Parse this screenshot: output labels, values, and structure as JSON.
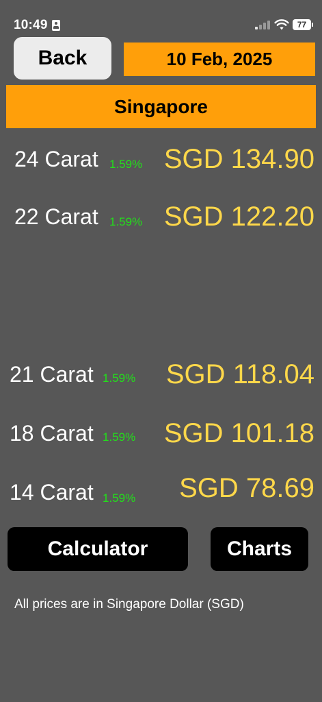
{
  "status_bar": {
    "time": "10:49",
    "battery": "77"
  },
  "header": {
    "back_label": "Back",
    "date": "10 Feb, 2025"
  },
  "location": "Singapore",
  "prices": [
    {
      "carat": "24 Carat",
      "change": "1.59%",
      "price": "SGD 134.90"
    },
    {
      "carat": "22 Carat",
      "change": "1.59%",
      "price": "SGD 122.20"
    },
    {
      "carat": "21 Carat",
      "change": "1.59%",
      "price": "SGD 118.04"
    },
    {
      "carat": "18 Carat",
      "change": "1.59%",
      "price": "SGD 101.18"
    },
    {
      "carat": "14 Carat",
      "change": "1.59%",
      "price": "SGD 78.69"
    }
  ],
  "buttons": {
    "calculator": "Calculator",
    "charts": "Charts"
  },
  "footnote": "All prices are in Singapore Dollar (SGD)",
  "colors": {
    "background": "#575757",
    "accent": "#ff9f0a",
    "price": "#ffd84a",
    "change": "#22e01a"
  }
}
